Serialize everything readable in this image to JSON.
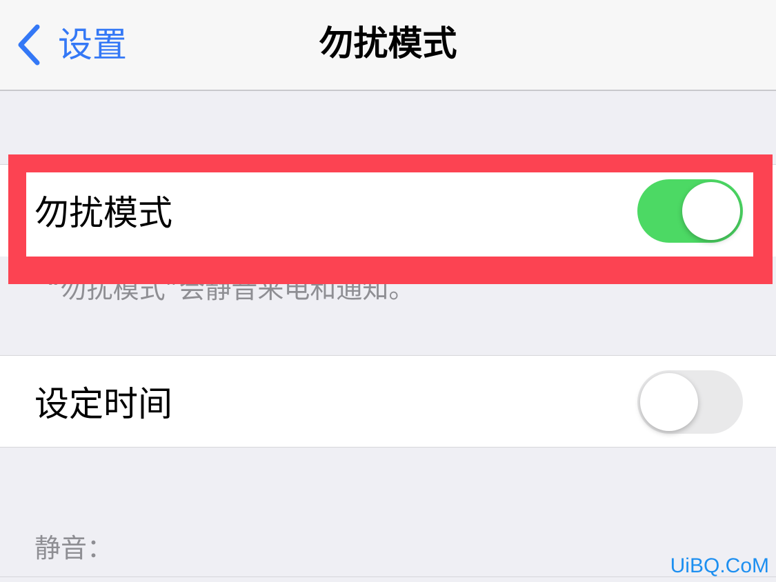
{
  "nav": {
    "back_label": "设置",
    "title": "勿扰模式"
  },
  "dnd_cell": {
    "label": "勿扰模式",
    "toggle_state": "on"
  },
  "dnd_footer": "“勿扰模式”会静音来电和通知。",
  "schedule_cell": {
    "label": "设定时间",
    "toggle_state": "off"
  },
  "silence_header": "静音：",
  "watermark": "UiBQ.CoM",
  "colors": {
    "accent_blue": "#3478f6",
    "toggle_on": "#4cd964",
    "toggle_off": "#e9e9ea",
    "highlight_red": "#fc4352",
    "watermark_blue": "#1d8ff0"
  },
  "icons": {
    "back": "chevron-left-icon"
  }
}
